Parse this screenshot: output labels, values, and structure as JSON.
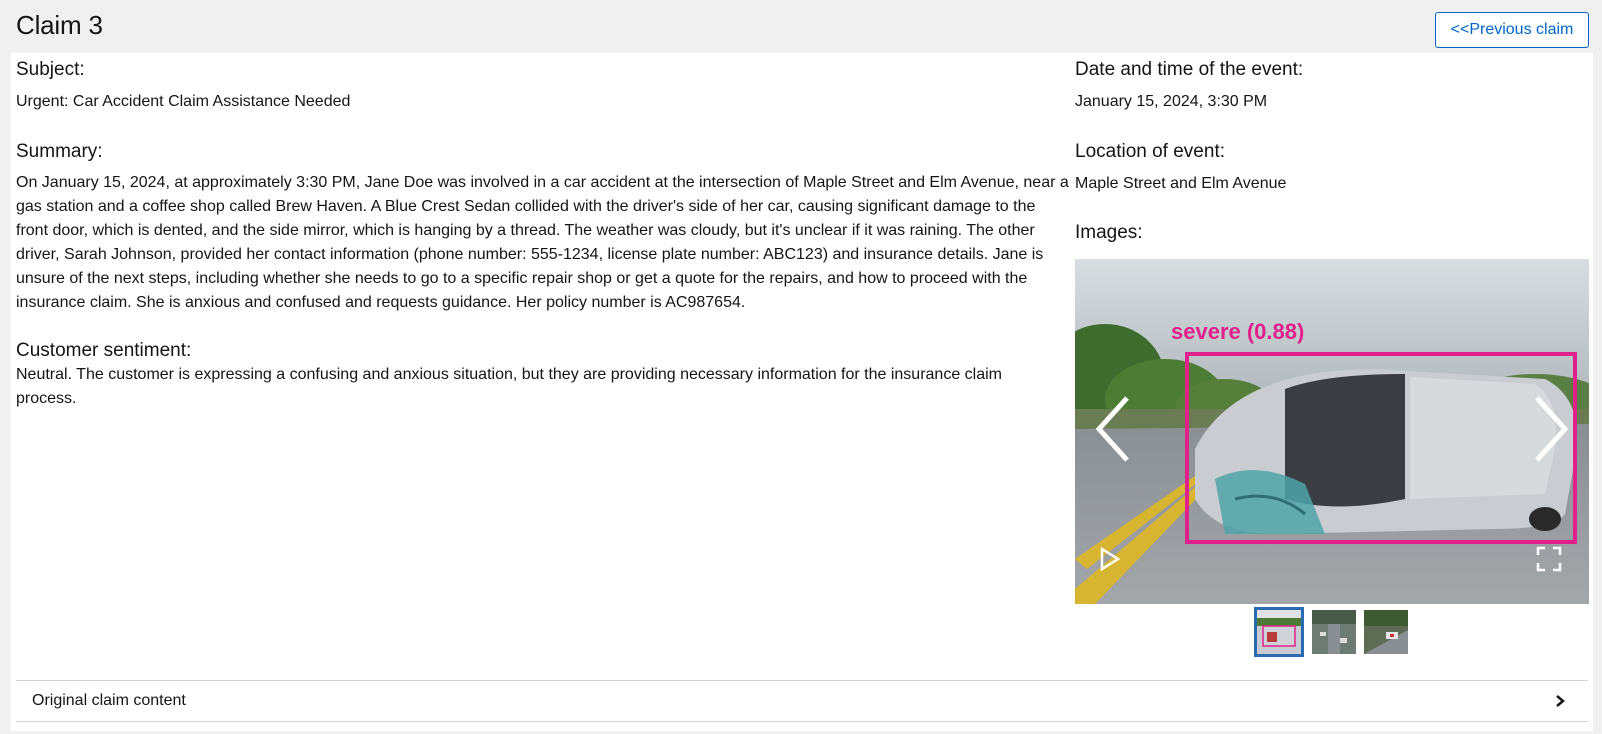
{
  "header": {
    "title": "Claim 3",
    "previous_label": "<<Previous claim"
  },
  "left": {
    "subject_label": "Subject:",
    "subject_value": "Urgent: Car Accident Claim Assistance Needed",
    "summary_label": "Summary:",
    "summary_lines": [
      "On January 15, 2024, at approximately 3:30 PM, Jane Doe was involved in a car accident at the intersection of Maple Street and Elm Avenue, near a",
      "gas station and a coffee shop called Brew Haven. A Blue Crest Sedan collided with the driver's side of her car, causing significant damage to the",
      "front door, which is dented, and the side mirror, which is hanging by a thread. The weather was cloudy, but it's unclear if it was raining. The other",
      "driver, Sarah Johnson, provided her contact information (phone number: 555-1234, license plate number: ABC123) and insurance details. Jane is",
      "unsure of the next steps, including whether she needs to go to a specific repair shop or get a quote for the repairs, and how to proceed with the",
      "insurance claim. She is anxious and confused and requests guidance. Her policy number is AC987654."
    ],
    "sentiment_label": "Customer sentiment:",
    "sentiment_lines": [
      "Neutral. The customer is expressing a confusing and anxious situation, but they are providing necessary information for the insurance claim",
      "process."
    ]
  },
  "right": {
    "date_label": "Date and time of the event:",
    "date_value": "January 15, 2024, 3:30 PM",
    "location_label": "Location of event:",
    "location_value": "Maple Street and Elm Avenue",
    "images_label": "Images:",
    "detection_label": "severe (0.88)",
    "colors": {
      "detection_box": "#e0218a"
    }
  },
  "accordion": {
    "label": "Original claim content"
  }
}
